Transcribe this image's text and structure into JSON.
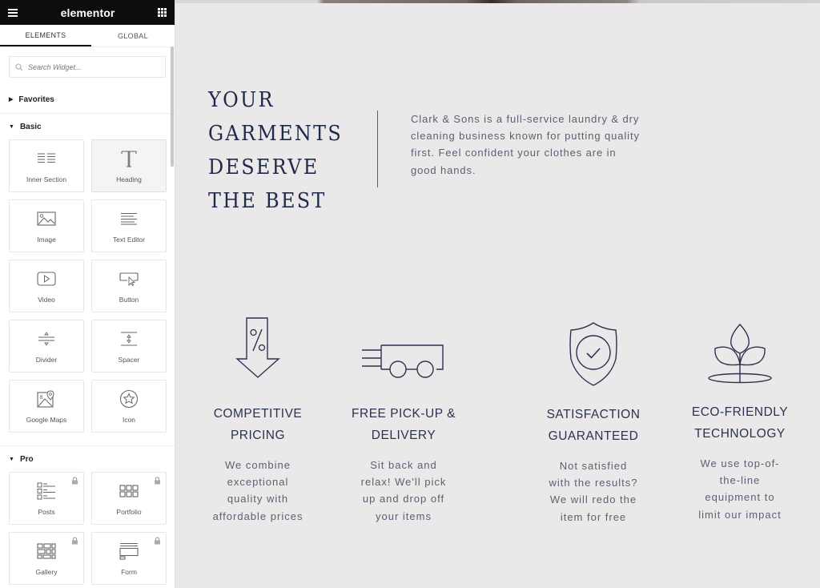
{
  "app": {
    "logo": "elementor",
    "menu_icon": "hamburger-icon",
    "apps_icon": "grid-icon"
  },
  "sidebar": {
    "tabs": [
      {
        "label": "ELEMENTS",
        "active": true
      },
      {
        "label": "GLOBAL",
        "active": false
      }
    ],
    "search": {
      "placeholder": "Search Widget...",
      "value": ""
    },
    "categories": {
      "favorites": {
        "label": "Favorites",
        "expanded": false
      },
      "basic": {
        "label": "Basic",
        "expanded": true
      },
      "pro": {
        "label": "Pro",
        "expanded": true
      }
    },
    "basic_widgets": [
      {
        "label": "Inner Section",
        "icon": "inner-section-icon"
      },
      {
        "label": "Heading",
        "icon": "heading-icon"
      },
      {
        "label": "Image",
        "icon": "image-icon"
      },
      {
        "label": "Text Editor",
        "icon": "text-editor-icon"
      },
      {
        "label": "Video",
        "icon": "video-icon"
      },
      {
        "label": "Button",
        "icon": "button-icon"
      },
      {
        "label": "Divider",
        "icon": "divider-icon"
      },
      {
        "label": "Spacer",
        "icon": "spacer-icon"
      },
      {
        "label": "Google Maps",
        "icon": "google-maps-icon"
      },
      {
        "label": "Icon",
        "icon": "star-icon"
      }
    ],
    "pro_widgets": [
      {
        "label": "Posts",
        "icon": "posts-icon",
        "locked": true
      },
      {
        "label": "Portfolio",
        "icon": "portfolio-icon",
        "locked": true
      },
      {
        "label": "Gallery",
        "icon": "gallery-icon",
        "locked": true
      },
      {
        "label": "Form",
        "icon": "form-icon",
        "locked": true
      }
    ],
    "collapse_icon": "chevron-left-icon"
  },
  "page": {
    "headline": [
      "YOUR",
      "GARMENTS",
      "DESERVE",
      "THE BEST"
    ],
    "intro": "Clark & Sons is a full-service laundry & dry cleaning business known for putting quality first. Feel confident your clothes are in good hands.",
    "features": [
      {
        "icon": "percent-down-arrow-icon",
        "title_lines": [
          "COMPETITIVE",
          "PRICING"
        ],
        "desc_lines": [
          "We combine",
          "exceptional",
          "quality with",
          "affordable prices"
        ]
      },
      {
        "icon": "delivery-truck-icon",
        "title_lines": [
          "FREE PICK-UP &",
          "DELIVERY"
        ],
        "desc_lines": [
          "Sit back and",
          "relax! We'll pick",
          "up and drop off",
          "your items"
        ]
      },
      {
        "icon": "shield-check-icon",
        "title_lines": [
          "SATISFACTION",
          "GUARANTEED"
        ],
        "desc_lines": [
          "Not satisfied",
          "with the results?",
          "We will redo the",
          "item for free"
        ]
      },
      {
        "icon": "plant-icon",
        "title_lines": [
          "ECO-FRIENDLY",
          "TECHNOLOGY"
        ],
        "desc_lines": [
          "We use top-of-",
          "the-line",
          "equipment to",
          "limit our impact"
        ]
      }
    ]
  },
  "colors": {
    "brand_dark": "#0c0d0e",
    "canvas_bg": "#ebe8e9",
    "heading_navy": "#1f2a48",
    "body_text": "#5d6072"
  }
}
